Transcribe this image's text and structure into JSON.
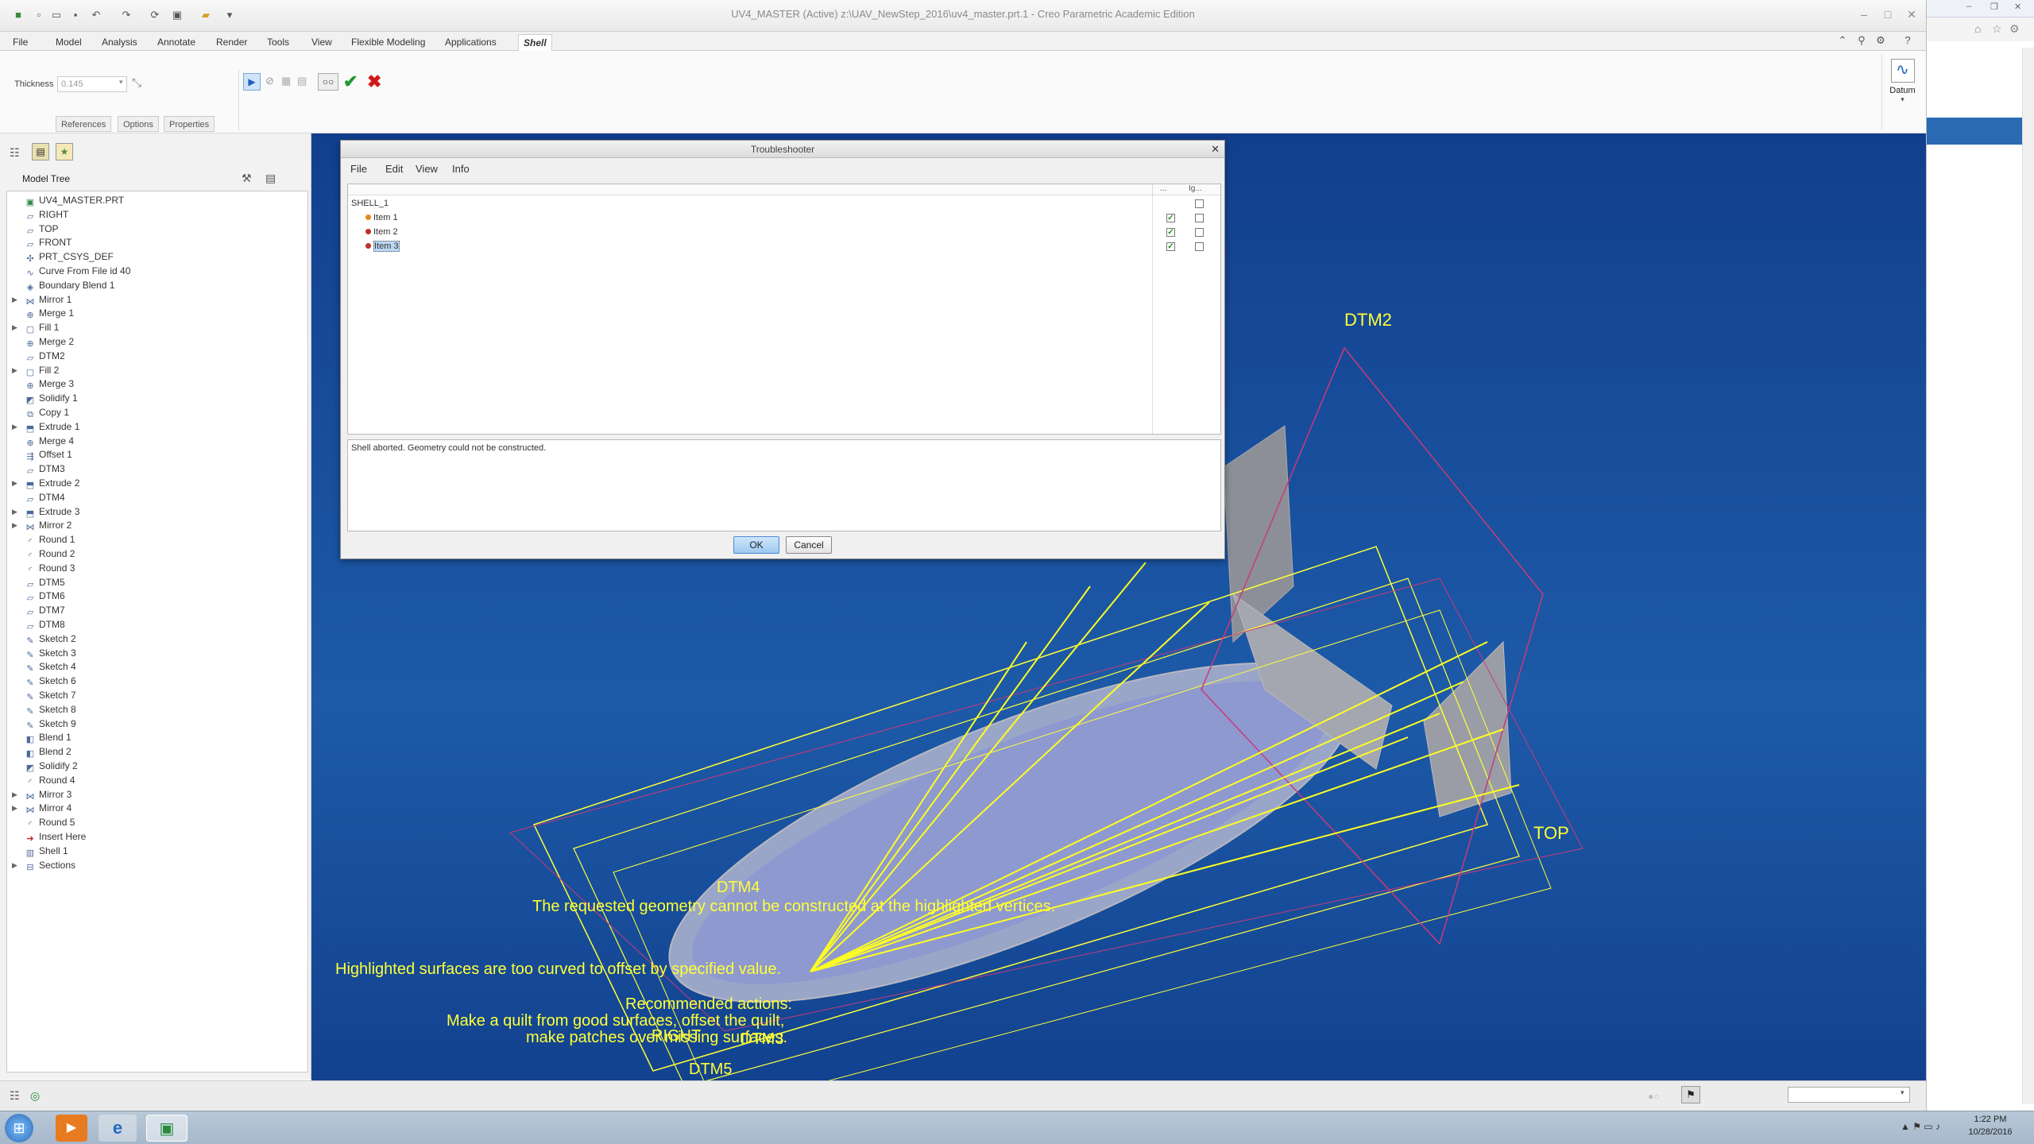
{
  "window": {
    "title": "UV4_MASTER (Active) z:\\UAV_NewStep_2016\\uv4_master.prt.1 - Creo Parametric Academic Edition"
  },
  "ribbon": {
    "tabs": [
      "File",
      "Model",
      "Analysis",
      "Annotate",
      "Render",
      "Tools",
      "View",
      "Flexible Modeling",
      "Applications",
      "Shell"
    ],
    "active_tab": "Shell",
    "datum_label": "Datum"
  },
  "dashboard": {
    "thickness_label": "Thickness",
    "thickness_value": "0.145",
    "subtabs": [
      "References",
      "Options",
      "Properties"
    ]
  },
  "model_tree": {
    "header": "Model Tree",
    "items": [
      {
        "label": "UV4_MASTER.PRT",
        "icon": "part-icon",
        "expandable": false
      },
      {
        "label": "RIGHT",
        "icon": "datum-plane-icon",
        "expandable": false
      },
      {
        "label": "TOP",
        "icon": "datum-plane-icon",
        "expandable": false
      },
      {
        "label": "FRONT",
        "icon": "datum-plane-icon",
        "expandable": false
      },
      {
        "label": "PRT_CSYS_DEF",
        "icon": "csys-icon",
        "expandable": false
      },
      {
        "label": "Curve From File id 40",
        "icon": "curve-icon",
        "expandable": false
      },
      {
        "label": "Boundary Blend 1",
        "icon": "boundary-blend-icon",
        "expandable": false
      },
      {
        "label": "Mirror 1",
        "icon": "mirror-icon",
        "expandable": true
      },
      {
        "label": "Merge 1",
        "icon": "merge-icon",
        "expandable": false
      },
      {
        "label": "Fill 1",
        "icon": "fill-icon",
        "expandable": true
      },
      {
        "label": "Merge 2",
        "icon": "merge-icon",
        "expandable": false
      },
      {
        "label": "DTM2",
        "icon": "datum-plane-icon",
        "expandable": false
      },
      {
        "label": "Fill 2",
        "icon": "fill-icon",
        "expandable": true
      },
      {
        "label": "Merge 3",
        "icon": "merge-icon",
        "expandable": false
      },
      {
        "label": "Solidify 1",
        "icon": "solidify-icon",
        "expandable": false
      },
      {
        "label": "Copy 1",
        "icon": "copy-icon",
        "expandable": false
      },
      {
        "label": "Extrude 1",
        "icon": "extrude-icon",
        "expandable": true
      },
      {
        "label": "Merge 4",
        "icon": "merge-icon",
        "expandable": false
      },
      {
        "label": "Offset 1",
        "icon": "offset-icon",
        "expandable": false
      },
      {
        "label": "DTM3",
        "icon": "datum-plane-icon",
        "expandable": false
      },
      {
        "label": "Extrude 2",
        "icon": "extrude-icon",
        "expandable": true
      },
      {
        "label": "DTM4",
        "icon": "datum-plane-icon",
        "expandable": false
      },
      {
        "label": "Extrude 3",
        "icon": "extrude-icon",
        "expandable": true
      },
      {
        "label": "Mirror 2",
        "icon": "mirror-icon",
        "expandable": true
      },
      {
        "label": "Round 1",
        "icon": "round-icon",
        "expandable": false
      },
      {
        "label": "Round 2",
        "icon": "round-icon",
        "expandable": false
      },
      {
        "label": "Round 3",
        "icon": "round-icon",
        "expandable": false
      },
      {
        "label": "DTM5",
        "icon": "datum-plane-icon",
        "expandable": false
      },
      {
        "label": "DTM6",
        "icon": "datum-plane-icon",
        "expandable": false
      },
      {
        "label": "DTM7",
        "icon": "datum-plane-icon",
        "expandable": false
      },
      {
        "label": "DTM8",
        "icon": "datum-plane-icon",
        "expandable": false
      },
      {
        "label": "Sketch 2",
        "icon": "sketch-icon",
        "expandable": false
      },
      {
        "label": "Sketch 3",
        "icon": "sketch-icon",
        "expandable": false
      },
      {
        "label": "Sketch 4",
        "icon": "sketch-icon",
        "expandable": false
      },
      {
        "label": "Sketch 6",
        "icon": "sketch-icon",
        "expandable": false
      },
      {
        "label": "Sketch 7",
        "icon": "sketch-icon",
        "expandable": false
      },
      {
        "label": "Sketch 8",
        "icon": "sketch-icon",
        "expandable": false
      },
      {
        "label": "Sketch 9",
        "icon": "sketch-icon",
        "expandable": false
      },
      {
        "label": "Blend 1",
        "icon": "blend-icon",
        "expandable": false
      },
      {
        "label": "Blend 2",
        "icon": "blend-icon",
        "expandable": false
      },
      {
        "label": "Solidify 2",
        "icon": "solidify-icon",
        "expandable": false
      },
      {
        "label": "Round 4",
        "icon": "round-icon",
        "expandable": false
      },
      {
        "label": "Mirror 3",
        "icon": "mirror-icon",
        "expandable": true
      },
      {
        "label": "Mirror 4",
        "icon": "mirror-icon",
        "expandable": true
      },
      {
        "label": "Round 5",
        "icon": "round-icon",
        "expandable": false
      },
      {
        "label": "Insert Here",
        "icon": "insert-here-icon",
        "expandable": false
      },
      {
        "label": "Shell 1",
        "icon": "shell-icon",
        "expandable": false
      },
      {
        "label": "Sections",
        "icon": "sections-icon",
        "expandable": true
      }
    ]
  },
  "troubleshooter": {
    "title": "Troubleshooter",
    "menu": [
      "File",
      "Edit",
      "View",
      "Info"
    ],
    "col_dots": "...",
    "col_ignore": "Ig...",
    "root": "SHELL_1",
    "items": [
      {
        "label": "Item 1",
        "status_color": "#e08a1e",
        "checked": true,
        "ignored": false
      },
      {
        "label": "Item 2",
        "status_color": "#c0302a",
        "checked": true,
        "ignored": false
      },
      {
        "label": "Item 3",
        "status_color": "#c0302a",
        "checked": true,
        "ignored": false,
        "selected": true
      }
    ],
    "message": "Shell aborted. Geometry could not be constructed.",
    "ok_label": "OK",
    "cancel_label": "Cancel"
  },
  "graphics": {
    "datum_labels": [
      "DTM2",
      "TOP",
      "DTM4",
      "RIGHT",
      "DTM5",
      "DTM3"
    ],
    "messages": {
      "line1": "The requested geometry cannot be constructed at the highlighted vertices.",
      "line2": "Highlighted surfaces are too curved to offset by specified value.",
      "line3": "Recommended actions:",
      "line4": "Make a quilt from good surfaces, offset the quilt,",
      "line5": "make patches over missing surfaces."
    }
  },
  "taskbar": {
    "time": "1:22 PM",
    "date": "10/28/2016"
  },
  "colors": {
    "overlay_text": "#ffff38",
    "background_top": "#113f8e",
    "background_bottom": "#1d5aa8"
  }
}
